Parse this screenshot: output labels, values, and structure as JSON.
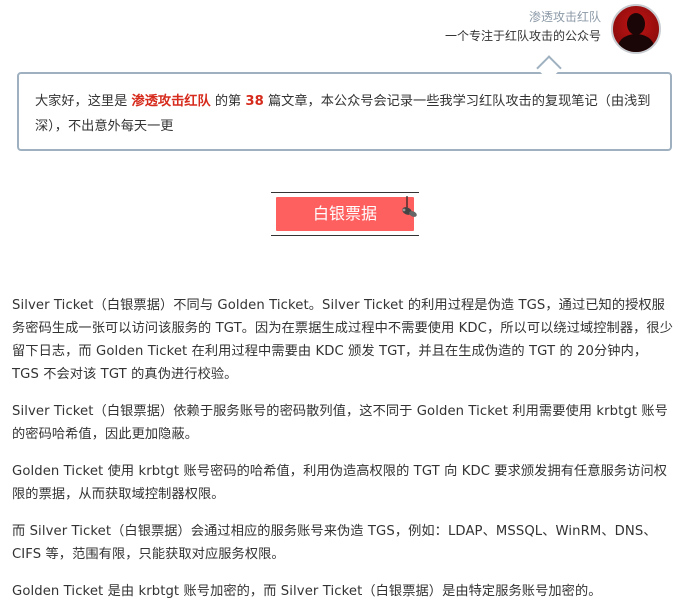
{
  "header": {
    "author_name": "渗透攻击红队",
    "author_tagline": "一个专注于红队攻击的公众号"
  },
  "intro": {
    "prefix": "大家好，这里是 ",
    "account_name": "渗透攻击红队",
    "middle": " 的第 ",
    "article_number": "38",
    "suffix": " 篇文章，本公众号会记录一些我学习红队攻击的复现笔记（由浅到深），不出意外每天一更"
  },
  "section": {
    "title": "白银票据"
  },
  "paragraphs": [
    "Silver Ticket（白银票据）不同与 Golden Ticket。Silver Ticket 的利用过程是伪造 TGS，通过已知的授权服务密码生成一张可以访问该服务的 TGT。因为在票据生成过程中不需要使用 KDC，所以可以绕过域控制器，很少留下日志，而 Golden Ticket 在利用过程中需要由 KDC 颁发 TGT，并且在生成伪造的 TGT 的 20分钟内，TGS 不会对该 TGT 的真伪进行校验。",
    "Silver Ticket（白银票据）依赖于服务账号的密码散列值，这不同于 Golden Ticket 利用需要使用 krbtgt 账号的密码哈希值，因此更加隐蔽。",
    "Golden Ticket 使用 krbtgt 账号密码的哈希值，利用伪造高权限的 TGT 向 KDC 要求颁发拥有任意服务访问权限的票据，从而获取域控制器权限。",
    "而 Silver Ticket（白银票据）会通过相应的服务账号来伪造 TGS，例如：LDAP、MSSQL、WinRM、DNS、CIFS 等，范围有限，只能获取对应服务权限。",
    "Golden Ticket 是由 krbtgt 账号加密的，而 Silver Ticket（白银票据）是由特定服务账号加密的。"
  ],
  "colors": {
    "accent_red": "#d62b1c",
    "heading_bg": "#fe5f5f",
    "bubble_border": "#9fb1c0",
    "author_name": "#8c9aa8"
  },
  "icons": {
    "avatar": "avatar-silhouette",
    "pin": "pushpin-icon"
  }
}
